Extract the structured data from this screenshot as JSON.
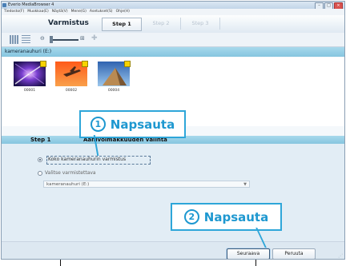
{
  "window": {
    "title": "Everio MediaBrowser 4",
    "menu": [
      "Tiedosto(F)",
      "Muokkaa(E)",
      "Näytä(V)",
      "Mene(G)",
      "Asetukset(S)",
      "Ohje(H)"
    ]
  },
  "toolbar": {
    "mode_label": "Varmistus",
    "steps": [
      "Step 1",
      "Step 2",
      "Step 3"
    ]
  },
  "device": {
    "label": "kameranauhuri (E:)"
  },
  "thumbnails": [
    {
      "label": "00001"
    },
    {
      "label": "00002"
    },
    {
      "label": "00004"
    }
  ],
  "step_header": {
    "step": "Step 1",
    "title": "Äänivoimakkuuden valinta"
  },
  "options": {
    "option1_label": "Koko kameranauhurin varmistus",
    "option2_label": "Valitse varmistettava",
    "select_value": "kameranauhuri (E:)"
  },
  "buttons": {
    "next": "Seuraava",
    "cancel": "Peruuta"
  },
  "callouts": {
    "callout1": {
      "number": "1",
      "text": "Napsauta"
    },
    "callout2": {
      "number": "2",
      "text": "Napsauta"
    }
  },
  "colors": {
    "accent": "#2ea6d9",
    "header_bar": "#86c5df",
    "panel": "#e2edf5"
  }
}
